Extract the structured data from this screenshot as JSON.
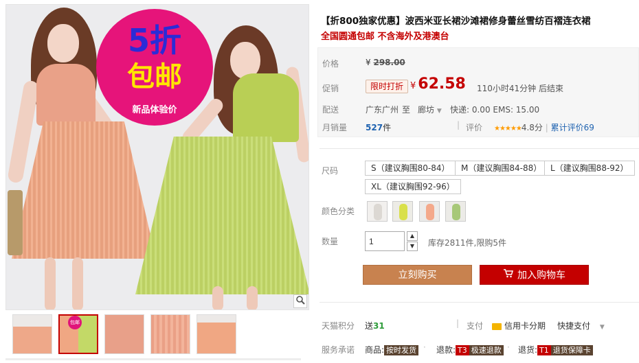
{
  "gallery": {
    "badge": {
      "line1": "5折",
      "line2": "包邮",
      "line3": "新品体验价"
    },
    "zoom_icon": "magnifier-icon",
    "thumb_pin": "包邮"
  },
  "product": {
    "title": "【折800独家优惠】波西米亚长裙沙滩裙修身蕾丝雪纺百褶连衣裙",
    "subtitle": "全国圆通包邮 不含海外及港澳台"
  },
  "price": {
    "label": "价格",
    "currency": "¥",
    "original": "298.00",
    "promo_label": "促销",
    "promo_tag": "限时打折",
    "promo_price": "62.58",
    "countdown": "110小时41分钟 后结束",
    "ship_label": "配送",
    "ship_from": "广东广州",
    "ship_to_word": "至",
    "ship_to": "廊坊",
    "ship_fee": "快递: 0.00 EMS: 15.00",
    "sales_label": "月销量",
    "sales_value": "527",
    "sales_unit": "件",
    "rating_label": "评价",
    "rating_stars": "★★★★★",
    "rating_score": "4.8分",
    "rating_link": "累计评价69"
  },
  "options": {
    "size_label": "尺码",
    "sizes": [
      "S（建议胸围80-84）",
      "M（建议胸围84-88）",
      "L（建议胸围88-92）",
      "XL（建议胸围92-96）"
    ],
    "color_label": "颜色分类",
    "colors": [
      "#f2f0ee",
      "#d9e04a",
      "#f4a98b",
      "#a7c878"
    ]
  },
  "quantity": {
    "label": "数量",
    "value": "1",
    "stock": "库存2811件,限购5件",
    "up": "▲",
    "down": "▼"
  },
  "buttons": {
    "buy": "立刻购买",
    "cart": "加入购物车"
  },
  "footer": {
    "points_label": "天猫积分",
    "points_prefix": "送",
    "points_value": "31",
    "pay_label": "支付",
    "pay_method": "信用卡分期",
    "pay_fast": "快捷支付",
    "service_label": "服务承诺",
    "service_goods": "商品:",
    "service_goods_tag": "按时发货",
    "service_refund": "退款:",
    "service_refund_tag1": "T3",
    "service_refund_tag2": "极速退款",
    "service_return": "退货:",
    "service_return_tag1": "T1",
    "service_return_tag2": "退货保障卡"
  },
  "colors": {
    "accent": "#c40000",
    "buy": "#c8824f",
    "link": "#1e62b0"
  }
}
